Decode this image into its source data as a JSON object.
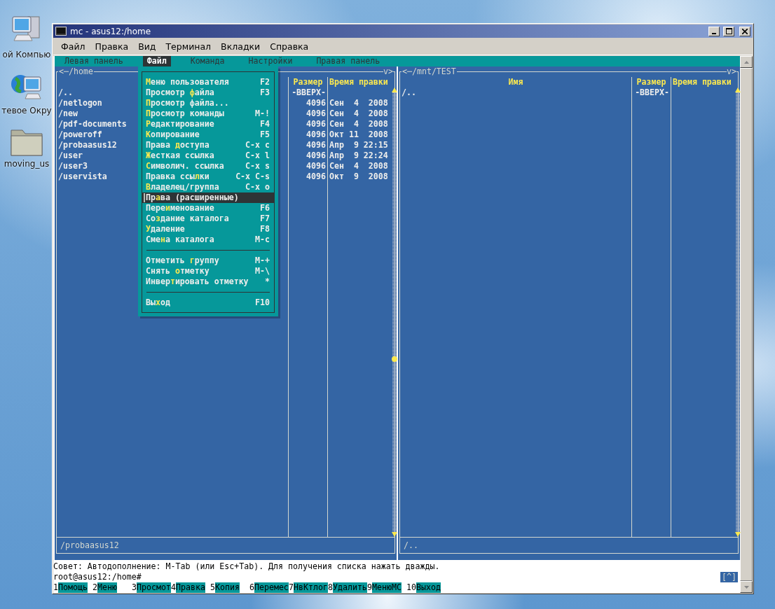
{
  "desktop_icons": [
    {
      "kind": "computer",
      "label": "ой Компью"
    },
    {
      "kind": "network",
      "label": "тевое Окру"
    },
    {
      "kind": "folder",
      "label": "moving_us"
    }
  ],
  "window": {
    "title": "mc - asus12:/home"
  },
  "menubar": [
    "Файл",
    "Правка",
    "Вид",
    "Терминал",
    "Вкладки",
    "Справка"
  ],
  "mc_menu": [
    {
      "label": "Левая панель",
      "selected": false
    },
    {
      "label": "Файл",
      "selected": true
    },
    {
      "label": "Команда",
      "selected": false
    },
    {
      "label": "Настройки",
      "selected": false
    },
    {
      "label": "Правая панель",
      "selected": false
    }
  ],
  "left_panel": {
    "title": "<─/home",
    "corner": "v>",
    "headers": {
      "size": "Размер",
      "time": "Время правки"
    },
    "scroll_thumb": true,
    "rows": [
      {
        "name": "/..",
        "size": "-ВВЕРХ-"
      },
      {
        "name": "/netlogon",
        "size": "4096",
        "time": "Сен  4  2008"
      },
      {
        "name": "/new",
        "size": "4096",
        "time": "Сен  4  2008"
      },
      {
        "name": "/pdf-documents",
        "size": "4096",
        "time": "Сен  4  2008"
      },
      {
        "name": "/poweroff",
        "size": "4096",
        "time": "Окт 11  2008"
      },
      {
        "name": "/probaasus12",
        "size": "4096",
        "time": "Апр  9 22:15"
      },
      {
        "name": "/user",
        "size": "4096",
        "time": "Апр  9 22:24"
      },
      {
        "name": "/user3",
        "size": "4096",
        "time": "Сен  4  2008"
      },
      {
        "name": "/uservista",
        "size": "4096",
        "time": "Окт  9  2008"
      }
    ],
    "mini_status": "/probaasus12"
  },
  "right_panel": {
    "title": "<─/mnt/TEST",
    "corner": "v>",
    "headers": {
      "name": "Имя",
      "size": "Размер",
      "time": "Время правки"
    },
    "scroll_thumb": false,
    "rows": [
      {
        "name": "/..",
        "size": "-ВВЕРХ-"
      }
    ],
    "mini_status": "/.."
  },
  "dropdown": [
    {
      "kind": "item",
      "key": "М",
      "after": "еню пользователя",
      "shortcut": "F2",
      "selected": false
    },
    {
      "kind": "item",
      "before": "Просмотр ",
      "key": "ф",
      "after": "айла",
      "shortcut": "F3",
      "selected": false
    },
    {
      "kind": "item",
      "key": "П",
      "after": "росмотр файла...",
      "selected": false
    },
    {
      "kind": "item",
      "key": "П",
      "after": "росмотр команды",
      "shortcut": "M-!",
      "selected": false
    },
    {
      "kind": "item",
      "key": "Р",
      "after": "едактирование",
      "shortcut": "F4",
      "selected": false
    },
    {
      "kind": "item",
      "key": "К",
      "after": "опирование",
      "shortcut": "F5",
      "selected": false
    },
    {
      "kind": "item",
      "before": "Права ",
      "key": "д",
      "after": "оступа",
      "shortcut": "C-x c",
      "selected": false
    },
    {
      "kind": "item",
      "key": "Ж",
      "after": "есткая ссылка",
      "shortcut": "C-x l",
      "selected": false
    },
    {
      "kind": "item",
      "key": "С",
      "after": "имволич. ссылка",
      "shortcut": "C-x s",
      "selected": false
    },
    {
      "kind": "item",
      "before": "Правка ссы",
      "key": "л",
      "after": "ки",
      "shortcut": "C-x C-s",
      "selected": false
    },
    {
      "kind": "item",
      "key": "В",
      "after": "ладелец/группа",
      "shortcut": "C-x o",
      "selected": false
    },
    {
      "kind": "item",
      "before": "Пр",
      "key": "а",
      "after": "ва (расширенные)",
      "selected": true
    },
    {
      "kind": "item",
      "before": "Пере",
      "key": "и",
      "after": "менование",
      "shortcut": "F6",
      "selected": false
    },
    {
      "kind": "item",
      "before": "Со",
      "key": "з",
      "after": "дание каталога",
      "shortcut": "F7",
      "selected": false
    },
    {
      "kind": "item",
      "key": "У",
      "after": "даление",
      "shortcut": "F8",
      "selected": false
    },
    {
      "kind": "item",
      "before": "Сме",
      "key": "н",
      "after": "а каталога",
      "shortcut": "M-c",
      "selected": false
    },
    {
      "kind": "separator"
    },
    {
      "kind": "item",
      "before": "Отметить ",
      "key": "г",
      "after": "руппу",
      "shortcut": "M-+",
      "selected": false
    },
    {
      "kind": "item",
      "before": "Снять ",
      "key": "о",
      "after": "тметку",
      "shortcut": "M-\\",
      "selected": false
    },
    {
      "kind": "item",
      "before": "Инвер",
      "key": "т",
      "after": "ировать отметку",
      "shortcut": "*",
      "selected": false
    },
    {
      "kind": "separator"
    },
    {
      "kind": "item",
      "before": "Вы",
      "key": "х",
      "after": "од",
      "shortcut": "F10",
      "selected": false
    }
  ],
  "hint": "Совет: Автодополнение: M-Tab (или Esc+Tab). Для получения списка нажать дважды.",
  "prompt": "root@asus12:/home#",
  "prompt_indicator": "[^]",
  "function_keys": [
    {
      "number": "1",
      "label": "Помощь"
    },
    {
      "number": "2",
      "label": "Меню"
    },
    {
      "number": "3",
      "label": "Просмот"
    },
    {
      "number": "4",
      "label": "Правка"
    },
    {
      "number": "5",
      "label": "Копия"
    },
    {
      "number": "6",
      "label": "Перемес"
    },
    {
      "number": "7",
      "label": "НвКтлог"
    },
    {
      "number": "8",
      "label": "Удалить"
    },
    {
      "number": "9",
      "label": "МенюМС"
    },
    {
      "number": "10",
      "label": "Выход"
    }
  ]
}
